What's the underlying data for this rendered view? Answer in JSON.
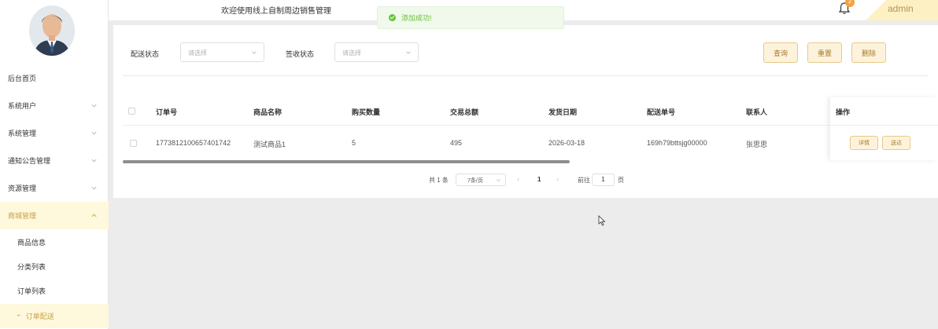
{
  "header": {
    "title": "欢迎使用线上自制周边销售管理",
    "notification_count": "2",
    "user": "admin"
  },
  "toast": {
    "message": "添加成功!"
  },
  "sidebar": {
    "items": [
      {
        "label": "后台首页"
      },
      {
        "label": "系统用户"
      },
      {
        "label": "系统管理"
      },
      {
        "label": "通知公告管理"
      },
      {
        "label": "资源管理"
      },
      {
        "label": "商城管理"
      }
    ],
    "sub_items": [
      {
        "label": "商品信息"
      },
      {
        "label": "分类列表"
      },
      {
        "label": "订单列表"
      },
      {
        "label": "订单配送",
        "marker": "•-"
      }
    ]
  },
  "filters": {
    "delivery_status_label": "配送状态",
    "delivery_status_placeholder": "请选择",
    "receipt_status_label": "签收状态",
    "receipt_status_placeholder": "请选择",
    "query_button": "查询",
    "reset_button": "重置",
    "delete_button": "删除"
  },
  "table": {
    "headers": [
      "订单号",
      "商品名称",
      "购买数量",
      "交易总额",
      "发货日期",
      "配送单号",
      "联系人",
      "操作"
    ],
    "rows": [
      {
        "order_no": "1773812100657401742",
        "product_name": "测试商品1",
        "quantity": "5",
        "total": "495",
        "ship_date": "2026-03-18",
        "delivery_no": "169h79bttsjg00000",
        "contact": "张思思",
        "detail_button": "详情",
        "deliver_button": "送达"
      }
    ]
  },
  "pagination": {
    "total": "共 1 条",
    "page_size": "7条/页",
    "current_page": "1",
    "goto_label": "前往",
    "goto_value": "1",
    "page_suffix": "页"
  }
}
